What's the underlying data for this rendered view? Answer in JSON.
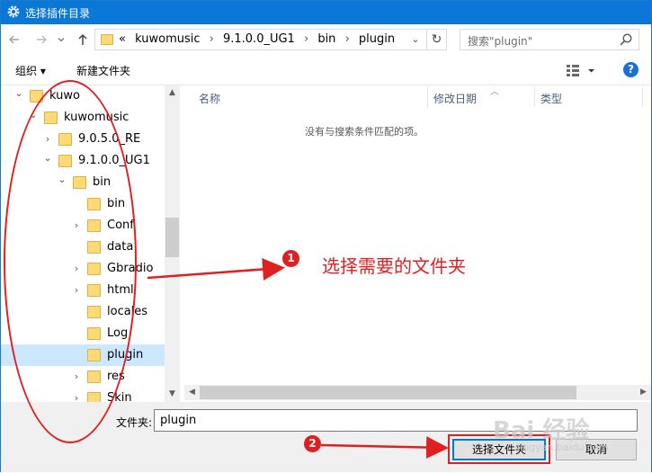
{
  "window": {
    "title": "选择插件目录",
    "title_bar_color": "#0b78d7"
  },
  "nav": {
    "back_icon": "arrow-left-icon",
    "forward_icon": "arrow-right-icon",
    "history_icon": "chevron-down-icon",
    "up_icon": "arrow-up-icon"
  },
  "address": {
    "overflow": "«",
    "crumbs": [
      "kuwomusic",
      "9.1.0.0_UG1",
      "bin",
      "plugin"
    ],
    "separator": "›",
    "dropdown_glyph": "⌄",
    "refresh_glyph": "↻"
  },
  "search": {
    "placeholder": "搜索\"plugin\""
  },
  "toolbar": {
    "organize": "组织 ▾",
    "new_folder": "新建文件夹",
    "help": "?"
  },
  "tree": {
    "items": [
      {
        "label": "kuwo",
        "level": 0,
        "expanded": true,
        "has_children": true
      },
      {
        "label": "kuwomusic",
        "level": 1,
        "expanded": true,
        "has_children": true
      },
      {
        "label": "9.0.5.0_RE",
        "level": 2,
        "expanded": false,
        "has_children": true
      },
      {
        "label": "9.1.0.0_UG1",
        "level": 2,
        "expanded": true,
        "has_children": true
      },
      {
        "label": "bin",
        "level": 3,
        "expanded": true,
        "has_children": true
      },
      {
        "label": "bin",
        "level": 4,
        "expanded": false,
        "has_children": false
      },
      {
        "label": "Conf",
        "level": 4,
        "expanded": false,
        "has_children": true
      },
      {
        "label": "data",
        "level": 4,
        "expanded": false,
        "has_children": false
      },
      {
        "label": "Gbradio",
        "level": 4,
        "expanded": false,
        "has_children": true
      },
      {
        "label": "html",
        "level": 4,
        "expanded": false,
        "has_children": true
      },
      {
        "label": "locales",
        "level": 4,
        "expanded": false,
        "has_children": false
      },
      {
        "label": "Log",
        "level": 4,
        "expanded": false,
        "has_children": false
      },
      {
        "label": "plugin",
        "level": 4,
        "expanded": false,
        "has_children": false,
        "selected": true
      },
      {
        "label": "res",
        "level": 4,
        "expanded": false,
        "has_children": true
      },
      {
        "label": "Skin",
        "level": 4,
        "expanded": false,
        "has_children": true
      }
    ]
  },
  "list": {
    "columns": [
      "名称",
      "修改日期",
      "类型"
    ],
    "empty_message": "没有与搜索条件匹配的项。"
  },
  "footer": {
    "filename_label": "文件夹:",
    "filename_value": "plugin",
    "ok_button": "选择文件夹",
    "cancel_button": "取消"
  },
  "annotations": {
    "callout_1_number": "1",
    "callout_1_text": "选择需要的文件夹",
    "callout_2_number": "2",
    "accent_color": "#e02020"
  },
  "watermark": {
    "text": "Bai 经验",
    "url": "jingyan.baidu.com"
  }
}
